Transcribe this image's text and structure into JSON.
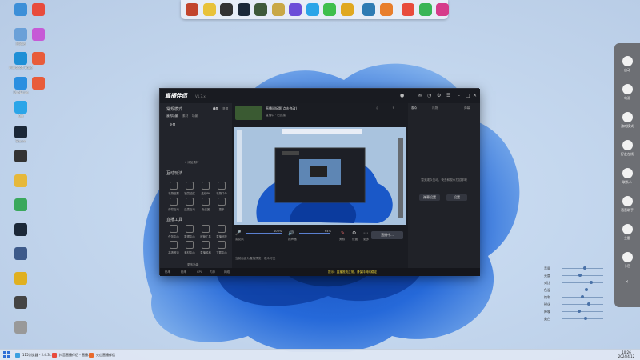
{
  "colors": {
    "accent": "#2f6fd6",
    "window_bg": "#1d1f26",
    "dock_bg": "#ebf0f8",
    "sidebar_bg": "#6d6f74"
  },
  "desktop": {
    "icons": [
      {
        "label": "",
        "color": "#3c8fd8",
        "icon": "computer-icon"
      },
      {
        "label": "回收站",
        "color": "#6aa0d8",
        "icon": "recycle-bin-icon"
      },
      {
        "label": "Microsoft Edge",
        "color": "#1e8fd6",
        "icon": "edge-icon"
      },
      {
        "label": "OneDrive",
        "color": "#2b8fe0",
        "icon": "onedrive-icon"
      },
      {
        "label": "QQ",
        "color": "#2ba5e8",
        "icon": "qq-icon"
      },
      {
        "label": "Steam",
        "color": "#1b2838",
        "icon": "steam-icon"
      },
      {
        "label": "",
        "color": "#333333",
        "icon": "app-icon"
      },
      {
        "label": "",
        "color": "#e6b83a",
        "icon": "app-icon"
      },
      {
        "label": "",
        "color": "#3aa85c",
        "icon": "app-icon"
      },
      {
        "label": "",
        "color": "#1b2838",
        "icon": "app-icon"
      },
      {
        "label": "",
        "color": "#3d5a8a",
        "icon": "app-icon"
      },
      {
        "label": "",
        "color": "#e0b020",
        "icon": "app-icon"
      },
      {
        "label": "",
        "color": "#444444",
        "icon": "app-icon"
      },
      {
        "label": "",
        "color": "#999999",
        "icon": "app-icon"
      }
    ],
    "icons_col2": [
      {
        "label": "",
        "color": "#e84b3c",
        "icon": "netease-icon"
      },
      {
        "label": "",
        "color": "#c65ad6",
        "icon": "app-icon"
      },
      {
        "label": "",
        "color": "#e85c3a",
        "icon": "app-icon"
      },
      {
        "label": "",
        "color": "#e85c3a",
        "icon": "app-icon"
      }
    ]
  },
  "dock": {
    "items": [
      {
        "color": "#c2452d",
        "icon": "game-icon"
      },
      {
        "color": "#e8c23a",
        "icon": "game-icon"
      },
      {
        "color": "#333333",
        "icon": "league-icon"
      },
      {
        "color": "#1b2838",
        "icon": "steam-icon"
      },
      {
        "color": "#3f5a3a",
        "icon": "game-icon"
      },
      {
        "color": "#c9a846",
        "icon": "game-icon"
      },
      {
        "color": "#6c4ed8",
        "icon": "game-icon"
      },
      {
        "color": "#2ba5e8",
        "icon": "qq-icon"
      },
      {
        "color": "#3fbf4c",
        "icon": "wechat-icon"
      },
      {
        "color": "#e0a820",
        "icon": "app-icon"
      },
      {
        "color": "#2e7bb3",
        "icon": "settings-icon"
      },
      {
        "color": "#e87e2c",
        "icon": "app-icon"
      },
      {
        "color": "#e84b3c",
        "icon": "netease-icon"
      },
      {
        "color": "#3ab556",
        "icon": "play-icon"
      },
      {
        "color": "#d63c8a",
        "icon": "app-icon"
      }
    ]
  },
  "sidebar": {
    "items": [
      {
        "label": "启动",
        "icon": "power-icon"
      },
      {
        "label": "电源",
        "icon": "battery-icon"
      },
      {
        "label": "游戏模式",
        "icon": "gamepad-icon"
      },
      {
        "label": "好友在线",
        "icon": "people-icon"
      },
      {
        "label": "联系人",
        "icon": "contact-icon"
      },
      {
        "label": "语音助手",
        "icon": "voice-icon"
      },
      {
        "label": "主题",
        "icon": "theme-icon"
      },
      {
        "label": "卡密",
        "icon": "key-icon"
      },
      {
        "label": "收起",
        "icon": "collapse-icon"
      }
    ]
  },
  "app": {
    "title": "直播伴侣",
    "version": "V1.7.x",
    "left": {
      "scene_header": "常规模式",
      "scene_tabs": [
        "横屏",
        "竖屏"
      ],
      "sub_tabs": [
        "我的场景",
        "素材",
        "场景"
      ],
      "scene_item": "全屏",
      "add_source": "+ 添加素材",
      "interactive_title": "互动玩法",
      "interactive": [
        "礼物投票",
        "福袋抽奖",
        "连线PK",
        "礼物口令",
        "弹幕互动",
        "连麦互动",
        "粉丝团",
        "更多"
      ],
      "tools_title": "直播工具",
      "tools": [
        "任务中心",
        "数据中心",
        "房管工具",
        "直播回放",
        "高清推流",
        "素材中心",
        "直播风格",
        "下载中心"
      ],
      "more": "更多功能"
    },
    "center": {
      "room_title": "直播间标题(点击修改)",
      "room_sub": "直播中 · 已连接",
      "preview_label": "",
      "mic_label": "麦克风",
      "mic_value": "100%",
      "speaker_label": "扬声器",
      "speaker_value": "64%",
      "btn_beauty": "美颜",
      "btn_live_settings": "设置",
      "btn_more": "更多",
      "start_button": "直播中...",
      "hint": "当前画面为直播预览，观众可见"
    },
    "right": {
      "tabs": [
        "观众",
        "礼物",
        "弹幕"
      ],
      "empty_text": "暂无观众互动，快去和观众打招呼吧",
      "btn_a": "弹幕设置",
      "btn_b": "设置"
    },
    "status": {
      "items": [
        "码率",
        "帧率",
        "CPU",
        "内存",
        "网络"
      ],
      "notice": "提示：直播推流正常，请保持网络稳定"
    }
  },
  "sliders": {
    "rows": [
      {
        "label": "音量",
        "value": 0.55
      },
      {
        "label": "亮度",
        "value": 0.45
      },
      {
        "label": "对比",
        "value": 0.72
      },
      {
        "label": "色温",
        "value": 0.6
      },
      {
        "label": "饱和",
        "value": 0.5
      },
      {
        "label": "锐化",
        "value": 0.66
      },
      {
        "label": "降噪",
        "value": 0.42
      },
      {
        "label": "美白",
        "value": 0.58
      }
    ]
  },
  "taskbar": {
    "items": [
      {
        "label": "115浏览器 - 2.4.3...",
        "color": "#3aa0e0"
      },
      {
        "label": "抖音直播伴侣 - 直播...",
        "color": "#e84b3c"
      },
      {
        "label": "火山直播伴侣",
        "color": "#e86a2c"
      }
    ],
    "time": "10:26",
    "date": "2024/4/12"
  }
}
